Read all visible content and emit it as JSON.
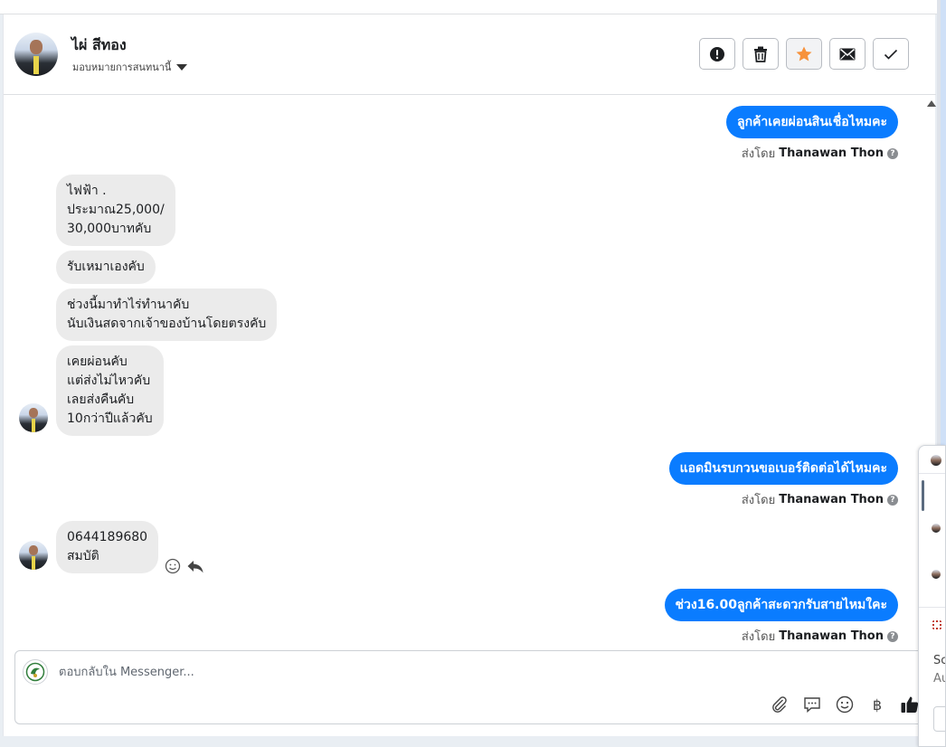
{
  "contact": {
    "name": "ไผ่ สีทอง",
    "assign_label": "มอบหมายการสนทนานี้"
  },
  "header_actions": [
    {
      "name": "spam",
      "icon": "alert-icon"
    },
    {
      "name": "delete",
      "icon": "trash-icon"
    },
    {
      "name": "star",
      "icon": "star-icon",
      "color": "#f7923b"
    },
    {
      "name": "mark-unread",
      "icon": "envelope-icon"
    },
    {
      "name": "done",
      "icon": "check-icon"
    }
  ],
  "messages": {
    "m1": {
      "text": "ลูกค้าเคยผ่อนสินเชื่อไหมคะ",
      "sent_by_label": "ส่งโดย",
      "sender": "Thanawan Thon"
    },
    "m2": {
      "lines": [
        "ไฟฟ้า .",
        "ประมาณ25,000/",
        "30,000บาทคับ"
      ]
    },
    "m3": {
      "text": "รับเหมาเองคับ"
    },
    "m4": {
      "lines": [
        "ช่วงนี้มาทำไร่ทำนาคับ",
        "นับเงินสดจากเจ้าของบ้านโดยตรงคับ"
      ]
    },
    "m5": {
      "lines": [
        "เคยผ่อนคับ",
        "แต่ส่งไม่ไหวคับ",
        "เลยส่งคืนคับ",
        "10กว่าปีแล้วคับ"
      ]
    },
    "m6": {
      "text": "แอดมินรบกวนขอเบอร์ติดต่อได้ไหมคะ",
      "sent_by_label": "ส่งโดย",
      "sender": "Thanawan Thon"
    },
    "m7": {
      "lines": [
        "0644189680",
        "สมบัติ"
      ]
    },
    "m8": {
      "text": "ช่วง16.00ลูกค้าสะดวกรับสายไหมใคะ",
      "sent_by_label": "ส่งโดย",
      "sender": "Thanawan Thon"
    }
  },
  "composer": {
    "placeholder": "ตอบกลับใน Messenger...",
    "tools": [
      "paperclip-icon",
      "speech-bubble-icon",
      "emoji-icon",
      "baht-icon",
      "thumbs-up-icon"
    ],
    "baht_symbol": "฿"
  },
  "side_panel": {
    "text_1": "Sc",
    "text_2": "Au"
  },
  "colors": {
    "outgoing_bubble": "#0a7cff",
    "incoming_bubble": "#ebebeb",
    "star": "#f7923b"
  }
}
